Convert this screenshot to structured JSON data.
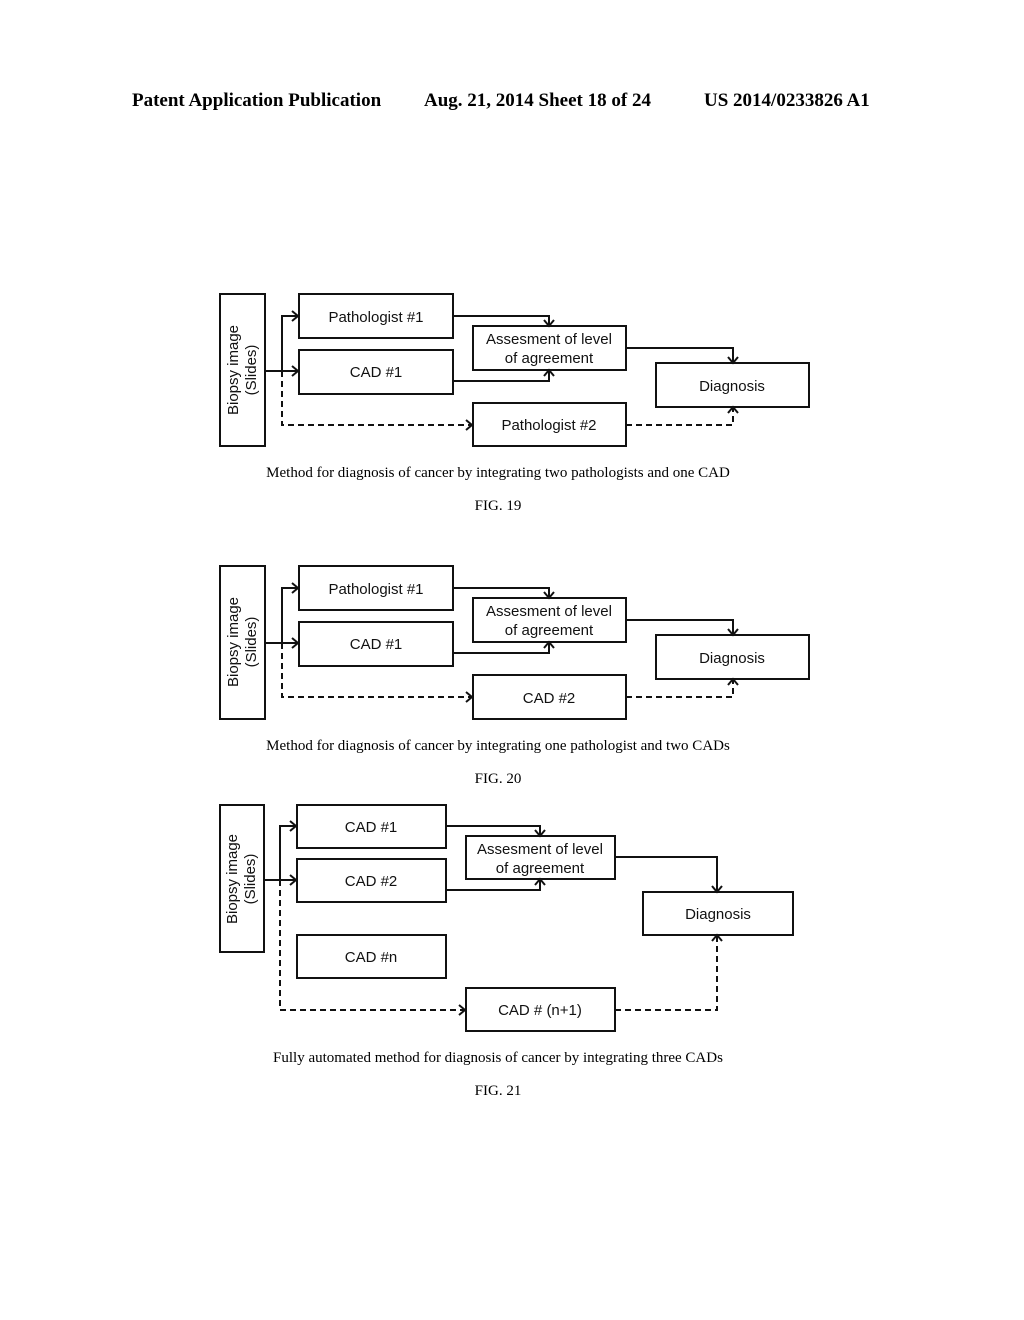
{
  "header": {
    "left": "Patent Application Publication",
    "center": "Aug. 21, 2014  Sheet 18 of 24",
    "right": "US 2014/0233826 A1"
  },
  "figures": [
    {
      "input": [
        "Biopsy image",
        "(Slides)"
      ],
      "top": "Pathologist #1",
      "middle": "CAD #1",
      "assess": [
        "Assesment of level",
        "of agreement"
      ],
      "diagnosis": "Diagnosis",
      "bottom": "Pathologist #2",
      "caption": "Method for diagnosis of cancer by integrating two pathologists and one CAD",
      "label": "FIG. 19"
    },
    {
      "input": [
        "Biopsy image",
        "(Slides)"
      ],
      "top": "Pathologist #1",
      "middle": "CAD #1",
      "assess": [
        "Assesment of level",
        "of agreement"
      ],
      "diagnosis": "Diagnosis",
      "bottom": "CAD #2",
      "caption": "Method for diagnosis of cancer by integrating one pathologist and two CADs",
      "label": "FIG. 20"
    },
    {
      "input": [
        "Biopsy image",
        "(Slides)"
      ],
      "top": "CAD #1",
      "middle": "CAD #2",
      "extra": "CAD #n",
      "assess": [
        "Assesment of level",
        "of agreement"
      ],
      "diagnosis": "Diagnosis",
      "bottom": "CAD # (n+1)",
      "caption": "Fully automated method for diagnosis of cancer by integrating three CADs",
      "label": "FIG. 21"
    }
  ]
}
